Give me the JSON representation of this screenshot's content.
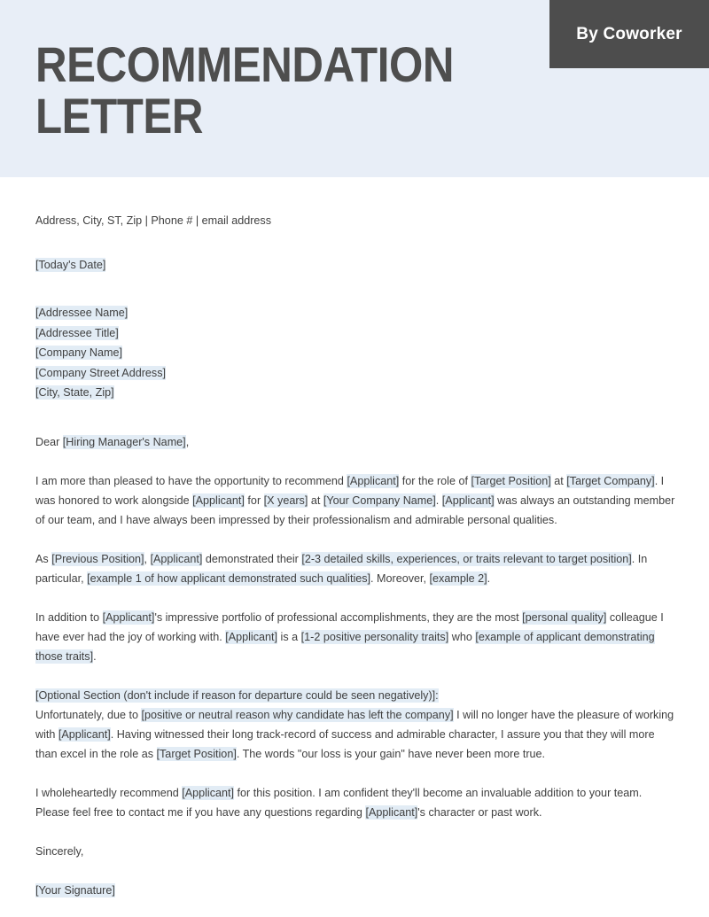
{
  "header": {
    "title": "RECOMMENDATION\nLETTER",
    "badge_label": "By Coworker",
    "band_color": "#e8eef7",
    "badge_color": "#4d4d4d",
    "title_color": "#4e4e4e"
  },
  "letter": {
    "contact_line": "Address, City, ST, Zip | Phone # | email address",
    "date": "[Today's Date]",
    "address_block": [
      "[Addressee Name]",
      "[Addressee Title]",
      "[Company Name]",
      "[Company Street Address]",
      "[City, State, Zip]"
    ],
    "salutation": {
      "prefix": "Dear ",
      "placeholder": "[Hiring Manager's Name]",
      "suffix": ","
    },
    "paragraph_1": {
      "t1": "I am more than pleased to have the opportunity to recommend ",
      "h1": "[Applicant]",
      "t2": " for the role of ",
      "h2": "[Target Position]",
      "t3": " at ",
      "h3": "[Target Company]",
      "t4": ". I was honored to work alongside ",
      "h4": "[Applicant]",
      "t5": " for ",
      "h5": "[X years]",
      "t6": " at ",
      "h6": "[Your Company Name]",
      "t7": ". ",
      "h7": "[Applicant]",
      "t8": " was always an outstanding member of our team, and I have always been impressed by their professionalism and admirable personal qualities."
    },
    "paragraph_2": {
      "t1": "As ",
      "h1": "[Previous Position]",
      "t2": ", ",
      "h2": "[Applicant]",
      "t3": " demonstrated their ",
      "h3": "[2-3 detailed skills, experiences, or traits relevant to target position]",
      "t4": ". In particular, ",
      "h4": "[example 1 of how applicant demonstrated such qualities]",
      "t5": ". Moreover, ",
      "h5": "[example 2]",
      "t6": "."
    },
    "paragraph_3": {
      "t1": "In addition to ",
      "h1": "[Applicant]",
      "t2": "'s impressive portfolio of professional accomplishments, they are the most ",
      "h2": "[personal quality]",
      "t3": " colleague I have ever had the joy of working with. ",
      "h3": "[Applicant]",
      "t4": " is a ",
      "h4": "[1-2 positive personality traits]",
      "t5": " who ",
      "h5": "[example of applicant demonstrating those traits]",
      "t6": "."
    },
    "optional_heading": {
      "h1": "[Optional Section (don't include if reason for departure could be seen negatively)]:"
    },
    "paragraph_4": {
      "t1": "Unfortunately, due to ",
      "h1": "[positive or neutral reason why candidate has left the company]",
      "t2": " I will no longer have the pleasure of working with ",
      "h2": "[Applicant]",
      "t3": ". Having witnessed their long track-record of success and admirable character, I assure you that they will more than excel in the role as ",
      "h3": "[Target Position]",
      "t4": ". The words \"our loss is your gain\" have never been more true."
    },
    "paragraph_5": {
      "t1": "I wholeheartedly recommend ",
      "h1": "[Applicant]",
      "t2": " for this position. I am confident they'll become an invaluable addition to your team. Please feel free to contact me if you have any questions regarding ",
      "h2": "[Applicant]",
      "t3": "'s character or past work."
    },
    "closing": "Sincerely,",
    "signature": "[Your Signature]"
  },
  "colors": {
    "highlight": "#e2ecf5",
    "body_text": "#3f3f3f"
  }
}
